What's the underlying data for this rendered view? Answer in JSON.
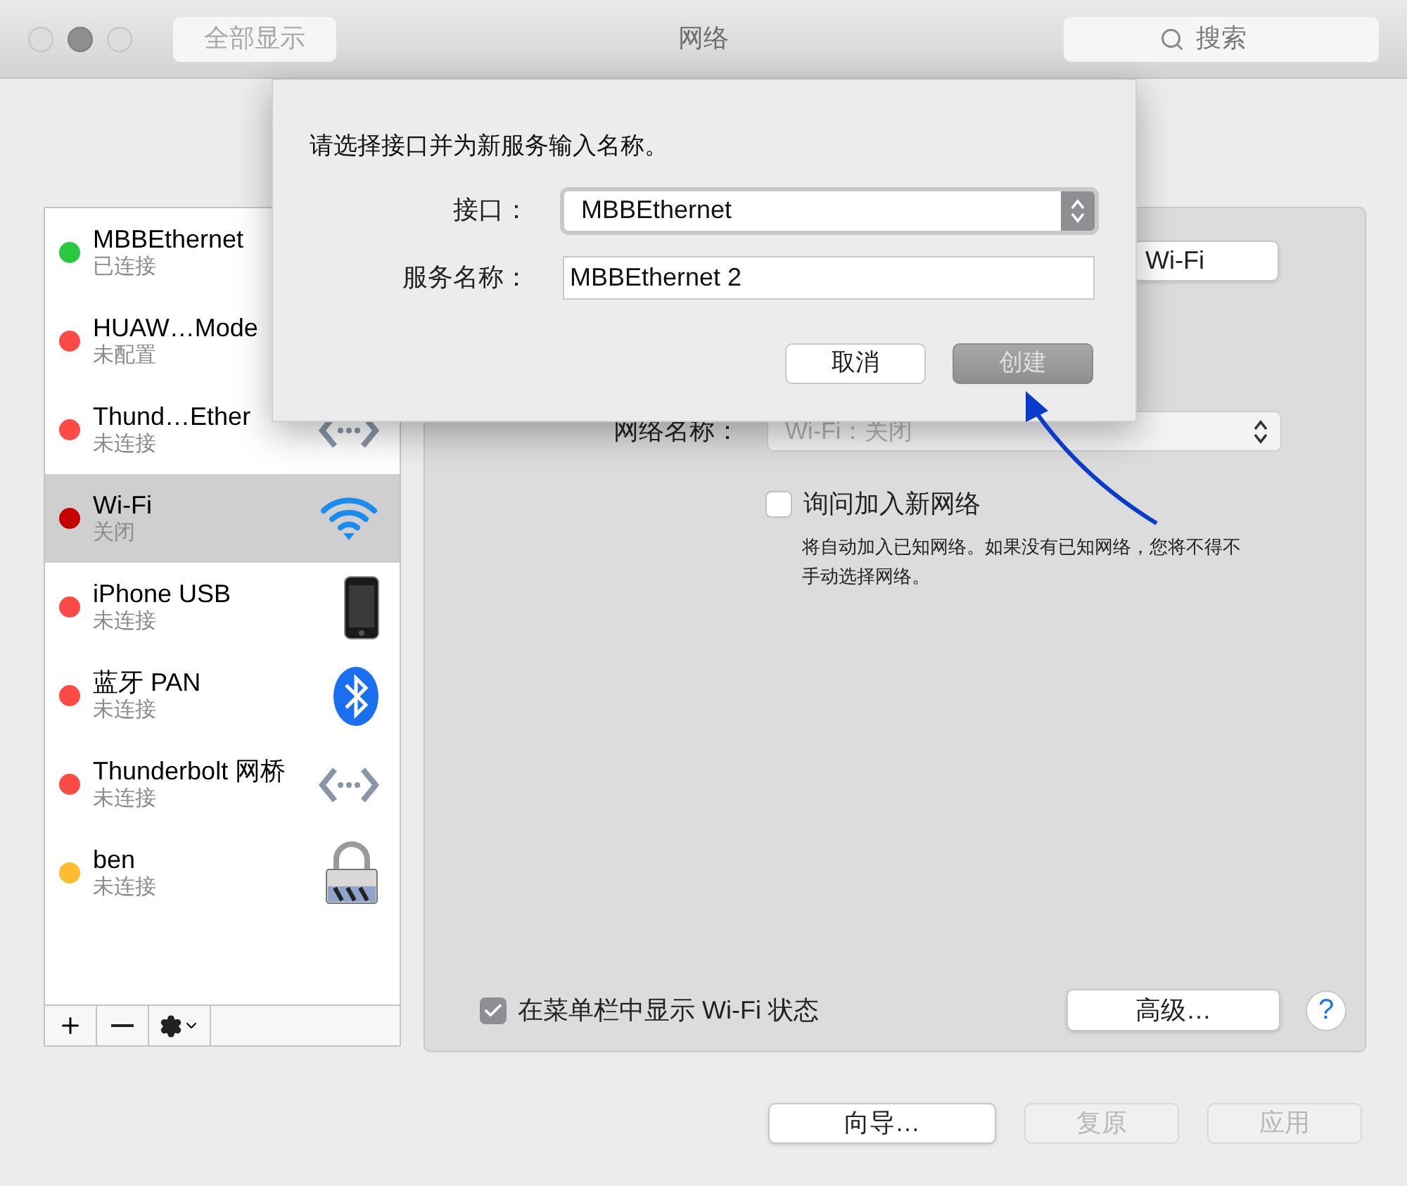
{
  "window": {
    "title": "网络"
  },
  "toolbar": {
    "show_all": "全部显示",
    "search": {
      "placeholder": "搜索"
    }
  },
  "services": [
    {
      "name": "MBBEthernet",
      "status": "已连接",
      "color": "#28c840",
      "selected": false
    },
    {
      "name": "HUAW…Mode",
      "status": "未配置",
      "color": "#fc4a46",
      "selected": false
    },
    {
      "name": "Thund…Ether",
      "status": "未连接",
      "color": "#fc4a46",
      "selected": false,
      "kind": "ethernet"
    },
    {
      "name": "Wi-Fi",
      "status": "关闭",
      "color": "#c40000",
      "selected": true,
      "kind": "wifi"
    },
    {
      "name": "iPhone USB",
      "status": "未连接",
      "color": "#fc4a46",
      "selected": false,
      "kind": "phone"
    },
    {
      "name": "蓝牙 PAN",
      "status": "未连接",
      "color": "#fc4a46",
      "selected": false,
      "kind": "bluetooth"
    },
    {
      "name": "Thunderbolt 网桥",
      "status": "未连接",
      "color": "#fc4a46",
      "selected": false,
      "kind": "ethernet"
    },
    {
      "name": "ben",
      "status": "未连接",
      "color": "#febc2e",
      "selected": false,
      "kind": "vpn"
    }
  ],
  "panel": {
    "wifi_button": "Wi-Fi",
    "network_name": {
      "label": "网络名称：",
      "value": "Wi-Fi：关闭",
      "disabled": true
    },
    "ask_join": {
      "label": "询问加入新网络",
      "checked": false,
      "description": "将自动加入已知网络。如果没有已知网络，您将不得不手动选择网络。"
    },
    "show_status": {
      "label": "在菜单栏中显示 Wi-Fi 状态",
      "checked": true
    },
    "advanced": "高级…",
    "help": "?"
  },
  "footer": [
    {
      "label": "向导…",
      "disabled": false
    },
    {
      "label": "复原",
      "disabled": true
    },
    {
      "label": "应用",
      "disabled": true
    }
  ],
  "dialog": {
    "prompt": "请选择接口并为新服务输入名称。",
    "interface": {
      "label": "接口：",
      "value": "MBBEthernet"
    },
    "service_name": {
      "label": "服务名称：",
      "value": "MBBEthernet 2"
    },
    "buttons": [
      {
        "label": "取消",
        "disabled": false
      },
      {
        "label": "创建",
        "disabled": true
      }
    ]
  }
}
